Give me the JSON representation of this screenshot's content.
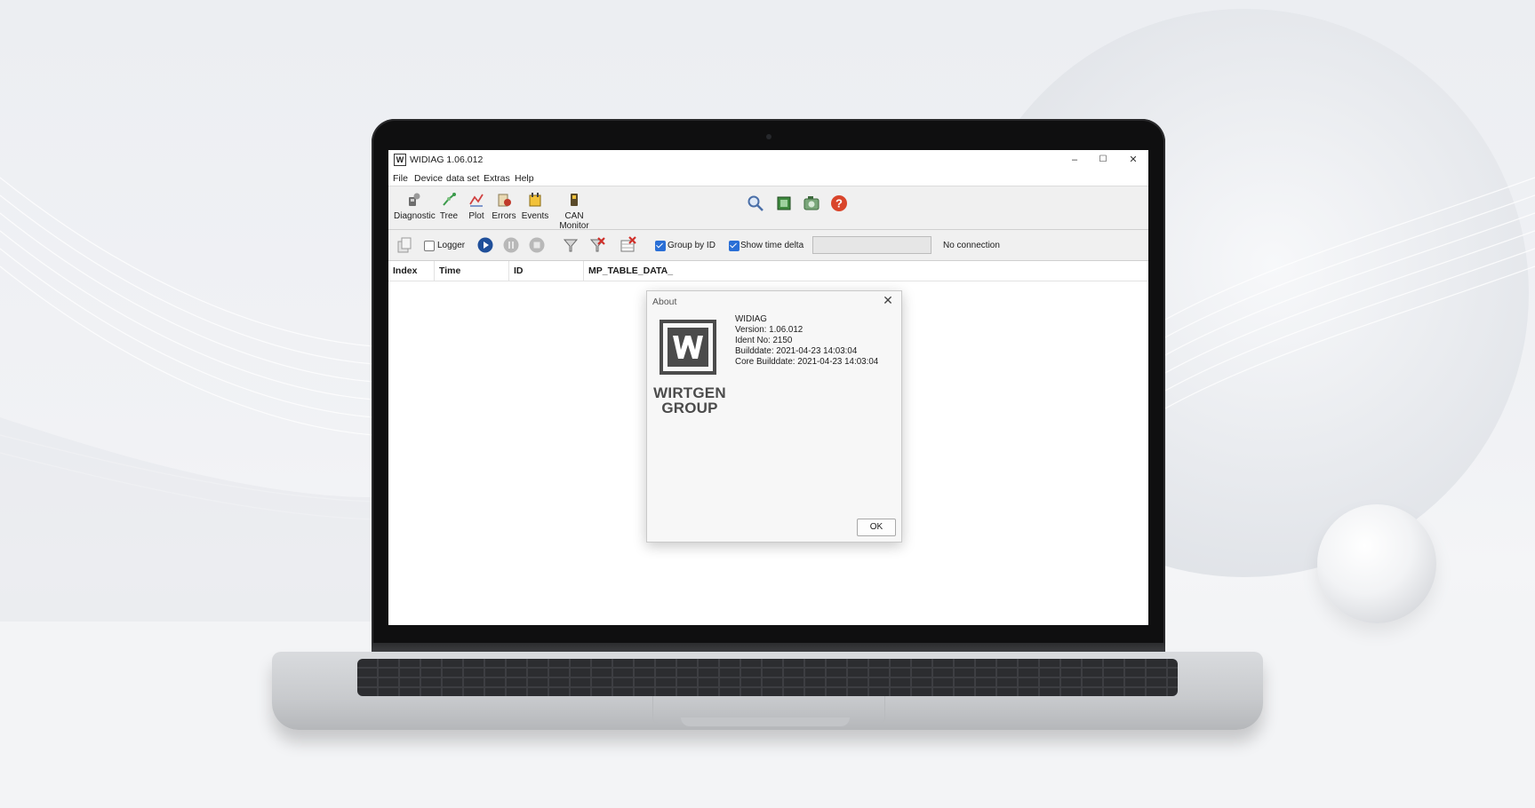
{
  "window": {
    "title": "WIDIAG 1.06.012",
    "controls": {
      "minimize": "–",
      "maximize": "☐",
      "close": "✕"
    }
  },
  "menubar": {
    "items": [
      "File",
      "Device",
      "data set",
      "Extras",
      "Help"
    ]
  },
  "toolbar": {
    "buttons": [
      "Diagnostic",
      "Tree",
      "Plot",
      "Errors",
      "Events",
      "CAN Monitor"
    ],
    "right_icons": [
      "search-icon",
      "chip-icon",
      "camera-icon",
      "help-icon"
    ]
  },
  "secondary_toolbar": {
    "logger_label": "Logger",
    "logger_checked": false,
    "group_by_id_label": "Group by ID",
    "group_by_id_checked": true,
    "show_time_delta_label": "Show time delta",
    "show_time_delta_checked": true,
    "status": "No connection"
  },
  "table": {
    "columns": [
      "Index",
      "Time",
      "ID",
      "MP_TABLE_DATA_"
    ]
  },
  "about_dialog": {
    "title": "About",
    "logo_text_line1": "WIRTGEN",
    "logo_text_line2": "GROUP",
    "info_lines": [
      "WIDIAG",
      "Version: 1.06.012",
      "Ident No: 2150",
      "Builddate: 2021-04-23 14:03:04",
      "Core Builddate: 2021-04-23 14:03:04"
    ],
    "ok_label": "OK",
    "close_glyph": "✕"
  },
  "colors": {
    "accent_blue": "#2a6fd6",
    "help_red": "#d9452b",
    "logo_gray": "#4b4b4b"
  }
}
